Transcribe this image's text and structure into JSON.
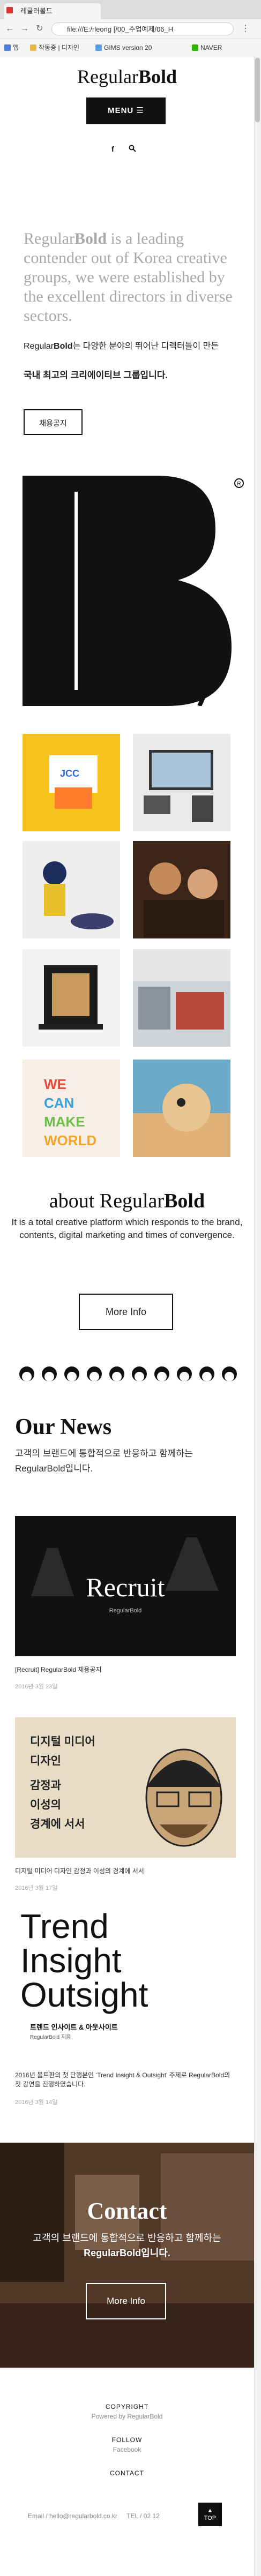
{
  "browser": {
    "tab_title": "레귤러볼드",
    "url": "file:///E:/rleong [/00_수업예제/06_H",
    "bookmarks": [
      "앱",
      "작동중 | 디자인",
      "GIMS version 20",
      "NAVER"
    ]
  },
  "header": {
    "logo_regular": "Regular",
    "logo_bold": "Bold",
    "menu_label": "MENU",
    "social": [
      "facebook-icon",
      "search-icon"
    ]
  },
  "intro": {
    "big_regular": "Regular",
    "big_bold": "Bold",
    "big_rest": " is a leading contender out of Korea creative groups, we were established by the excellent directors in diverse sectors.",
    "small_prefix": "Regular",
    "small_bold": "Bold",
    "small_rest": "는 다양한 분야의 뛰어난 디렉터들이 만든",
    "strong": "국내 최고의 크리에이티브 그룹입니다.",
    "recruit_label": "채용공지"
  },
  "about": {
    "title_regular": "about Regular",
    "title_bold": "Bold",
    "text": "It is a total creative platform which responds to the brand, contents, digital marketing and times of convergence.",
    "more_label": "More Info"
  },
  "news": {
    "title": "Our News",
    "desc": "고객의 브랜드에 통합적으로 반응하고 함께하는 RegularBold입니다.",
    "items": [
      {
        "img_title": "Recruit",
        "img_sub": "RegularBold",
        "caption": "[Recruit] RegularBold 채용공지",
        "date": "2016년 3월 23일"
      },
      {
        "img_lines": [
          "디지털 미디어",
          "디자인",
          "감정과",
          "이성의",
          "경계에 서서"
        ],
        "caption": "디지털 미디어 디자인 감정과 이성의 경계에 서서",
        "date": "2016년 3월 17일"
      },
      {
        "img_lines": [
          "Trend",
          "Insight",
          "Outsight"
        ],
        "img_sub": "트렌드 인사이트 & 아웃사이트",
        "img_sub2": "RegularBold 지음",
        "caption": "2016년 볼트판의 첫 단행본인 ‘Trend Insight & Outsight’ 주제로 RegularBold의 첫 강연을 진행하였습니다.",
        "date": "2016년 3월 14일"
      }
    ]
  },
  "contact": {
    "title": "Contact",
    "desc_line1": "고객의 브랜드에 통합적으로 반응하고 함께하는",
    "desc_line2": "RegularBold입니다.",
    "more_label": "More Info"
  },
  "footer": {
    "copyright_h": "COPYRIGHT",
    "copyright_v": "Powered by RegularBold",
    "follow_h": "FOLLOW",
    "follow_v": "Facebook",
    "contact_h": "CONTACT",
    "email": "Email / hello@regularbold.co.kr",
    "tel": "TEL / 02 12",
    "top_label": "TOP"
  }
}
